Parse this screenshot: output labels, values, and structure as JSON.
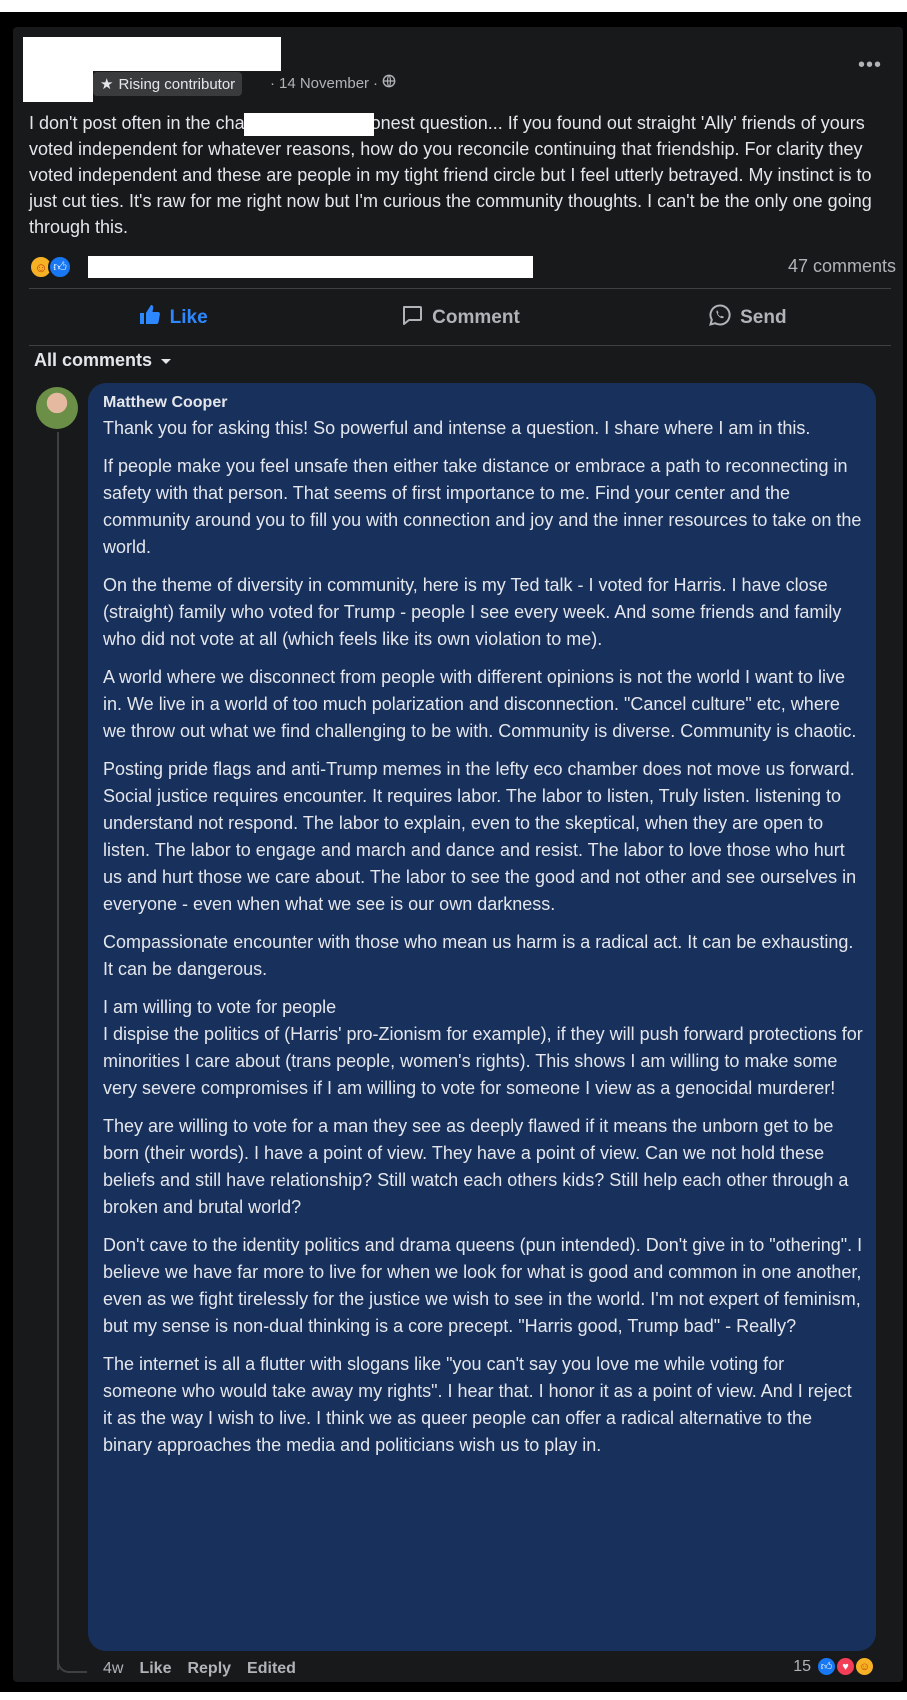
{
  "post": {
    "badge": "Rising contributor",
    "date": "14 November",
    "text_prefix": "I don't post often in the ",
    "text_main": "I don't post often in the                       chat but this is an honest question... If you found out straight 'Ally' friends of yours voted independent for whatever reasons, how do you reconcile continuing that friendship. For clarity they voted independent and these are people in my tight friend circle but I feel utterly betrayed. My instinct is to just cut ties. It's raw for me right now but I'm curious the community thoughts. I can't be the only one going through this.",
    "comments_count": "47 comments"
  },
  "actions": {
    "like": "Like",
    "comment": "Comment",
    "send": "Send"
  },
  "comments_filter": "All comments",
  "comment": {
    "author": "Matthew Cooper",
    "paragraphs": [
      "Thank you for asking this! So powerful and intense a question. I share where I am in this.",
      "If people make you feel unsafe then either take distance or embrace a path to reconnecting in safety with that person. That seems of first importance to me. Find your center and the community around you to fill you with connection and joy and the inner resources to take on the world.",
      "On the theme of diversity in community, here is my Ted talk - I voted for Harris. I have close (straight) family who voted for Trump - people I see every week. And some friends and family who did not vote at all (which feels like its own violation to me).",
      "A world where we disconnect from people with different opinions is not the world I want to live in. We live in a world of too much polarization and disconnection. \"Cancel culture\" etc, where we throw out what we find challenging to be with. Community is diverse. Community is chaotic.",
      "Posting pride flags and anti-Trump memes in the lefty eco chamber does not move us forward. Social justice requires encounter. It requires labor. The labor to listen, Truly listen. listening to understand not respond. The labor to explain, even to the skeptical, when they are open to listen. The labor to engage and march and dance and resist. The labor to love those who hurt us and hurt those we care about. The labor to see the good and not other and see ourselves in everyone - even when what we see is our own darkness.",
      "Compassionate encounter with those who mean us harm is a radical act. It can be exhausting. It can be dangerous.",
      "I am willing to vote for people\nI dispise the politics of (Harris' pro-Zionism for example), if they will push forward protections for minorities I care about (trans people, women's rights). This shows I am willing to make some very severe compromises if I am willing to vote for someone I view as a genocidal murderer!",
      "They are willing to vote for a man they see as deeply flawed if it means the unborn get to be born (their words). I have a point of view. They have a point of view. Can we not hold these beliefs and still have relationship? Still watch each others kids? Still help each other through a broken and brutal world?",
      "Don't cave to the identity politics and drama queens (pun intended). Don't give in to \"othering\". I believe we have far more to live for when we look for what is good and common in one another, even as we fight tirelessly for the justice we wish to see in the world. I'm not expert of feminism, but my sense is non-dual thinking is a core precept. \"Harris good, Trump bad\" - Really?",
      "The internet is all a flutter with slogans like \"you can't say you love me while voting for someone who would take away my rights\". I hear that. I honor it as a point of view. And I reject it as the way I wish to live. I think we as queer people can offer a radical alternative to the binary approaches the media and politicians wish us to play in."
    ],
    "time": "4w",
    "like": "Like",
    "reply": "Reply",
    "edited": "Edited",
    "reaction_count": "15"
  },
  "colors": {
    "background": "#18191a",
    "comment_bubble": "#17305c",
    "link_blue": "#2d88ff",
    "muted_text": "#b0b3b8"
  }
}
